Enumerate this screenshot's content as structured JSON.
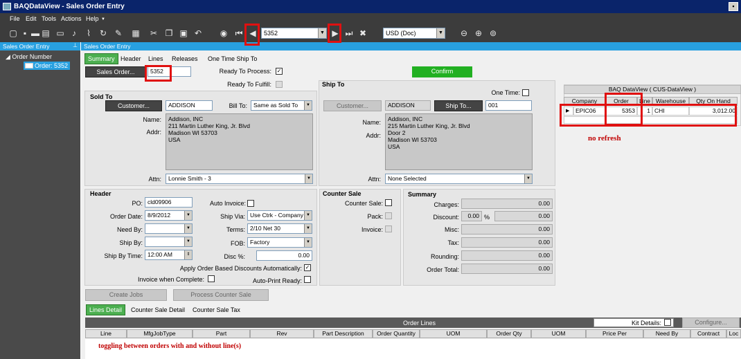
{
  "window": {
    "title": "BAQDataView - Sales Order Entry"
  },
  "menu": [
    "File",
    "Edit",
    "Tools",
    "Actions",
    "Help"
  ],
  "toolbar": {
    "order_nav_value": "5352",
    "currency_value": "USD (Doc)"
  },
  "left_panel": {
    "header": "Sales Order Entry",
    "tree_root": "Order Number",
    "tree_child": "Order: 5352"
  },
  "content_header": "Sales Order Entry",
  "top_tabs": [
    "Summary",
    "Header",
    "Lines",
    "Releases",
    "One Time Ship To"
  ],
  "top": {
    "sales_order_button": "Sales Order...",
    "sales_order_value": "5352",
    "ready_to_process": "Ready To Process:",
    "ready_to_fulfill": "Ready To Fulfill:",
    "confirm": "Confirm"
  },
  "sold_to": {
    "title": "Sold To",
    "customer_button": "Customer...",
    "customer_value": "ADDISON",
    "bill_to_label": "Bill To:",
    "bill_to_value": "Same as Sold To",
    "name_label": "Name:",
    "addr_label": "Addr:",
    "address": "Addison, INC\n211 Martin Luther King, Jr. Blvd\nMadison WI 53703\nUSA",
    "attn_label": "Attn:",
    "attn_value": "Lonnie Smith - 3"
  },
  "ship_to": {
    "title": "Ship To",
    "one_time_label": "One Time:",
    "customer_button": "Customer...",
    "customer_value": "ADDISON",
    "ship_to_button": "Ship To...",
    "ship_to_value": "001",
    "name_label": "Name:",
    "addr_label": "Addr:",
    "address": "Addison, INC\n215 Martin Luther King, Jr. Blvd\nDoor 2\nMadison WI 53703\nUSA",
    "attn_label": "Attn:",
    "attn_value": "None Selected"
  },
  "header": {
    "title": "Header",
    "po_label": "PO:",
    "po_value": "cld09906",
    "auto_invoice_label": "Auto Invoice:",
    "order_date_label": "Order Date:",
    "order_date_value": "8/9/2012",
    "ship_via_label": "Ship Via:",
    "ship_via_value": "Use Ctrk - Company",
    "need_by_label": "Need By:",
    "terms_label": "Terms:",
    "terms_value": "2/10 Net 30",
    "ship_by_label": "Ship By:",
    "fob_label": "FOB:",
    "fob_value": "Factory",
    "ship_by_time_label": "Ship By Time:",
    "ship_by_time_value": "12:00 AM",
    "disc_label": "Disc %:",
    "disc_value": "0.00",
    "apply_discounts_label": "Apply Order Based Discounts Automatically:",
    "invoice_complete_label": "Invoice when Complete:",
    "auto_print_label": "Auto-Print Ready:"
  },
  "counter_sale": {
    "title": "Counter Sale",
    "counter_sale_label": "Counter Sale:",
    "pack_label": "Pack:",
    "invoice_label": "Invoice:"
  },
  "summary": {
    "title": "Summary",
    "charges_label": "Charges:",
    "charges_value": "0.00",
    "discount_label": "Discount:",
    "discount_pct": "0.00",
    "pct_sign": "%",
    "discount_value": "0.00",
    "misc_label": "Misc:",
    "misc_value": "0.00",
    "tax_label": "Tax:",
    "tax_value": "0.00",
    "rounding_label": "Rounding:",
    "rounding_value": "0.00",
    "order_total_label": "Order Total:",
    "order_total_value": "0.00"
  },
  "baq": {
    "title": "BAQ DataView ( CUS-DataView )",
    "columns": [
      "Company",
      "Order",
      "Line",
      "Warehouse",
      "Qty On Hand"
    ],
    "row": {
      "company": "EPIC06",
      "order": "5353",
      "line": "1",
      "warehouse": "CHI",
      "qty": "3,012.00"
    }
  },
  "annotations": {
    "no_refresh": "no refresh",
    "toggling": "toggling between orders with and without line(s)"
  },
  "action_buttons": {
    "create_jobs": "Create Jobs",
    "process_counter_sale": "Process Counter Sale"
  },
  "bottom_tabs": [
    "Lines Detail",
    "Counter Sale Detail",
    "Counter Sale Tax"
  ],
  "order_lines": {
    "title": "Order Lines",
    "kit_details_label": "Kit Details:",
    "configure": "Configure...",
    "columns": [
      "Line",
      "MfgJobType",
      "Part",
      "Rev",
      "Part Description",
      "Order Quantity",
      "UOM",
      "Order Qty",
      "UOM",
      "Price Per",
      "Need By",
      "Contract",
      "Loc"
    ]
  }
}
